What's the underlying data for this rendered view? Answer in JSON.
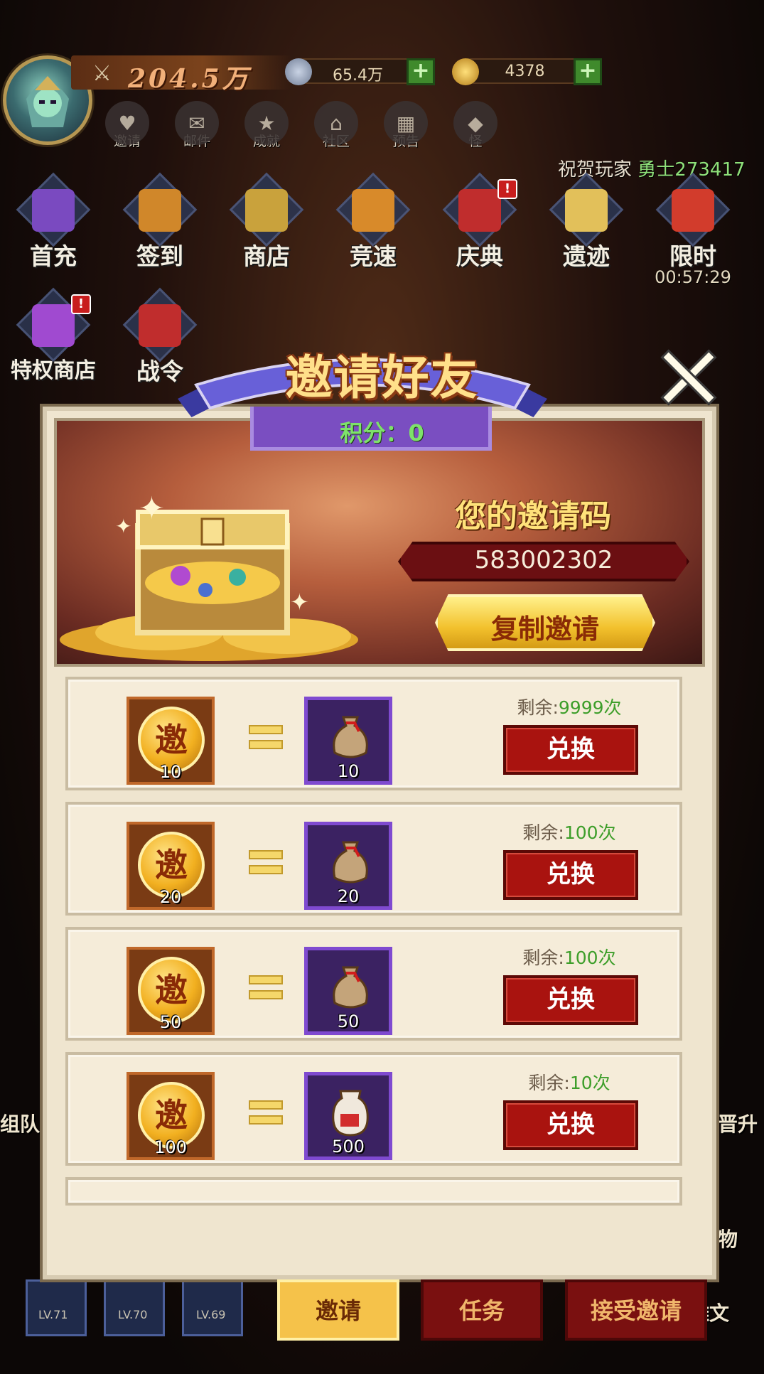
{
  "hud": {
    "power": "204.5万",
    "silver": "65.4万",
    "gold": "4378",
    "plus": "+"
  },
  "top_icons": [
    {
      "label": "邀请",
      "glyph": "♥",
      "icon": "heart-icon"
    },
    {
      "label": "邮件",
      "glyph": "✉",
      "icon": "mail-icon"
    },
    {
      "label": "成就",
      "glyph": "★",
      "icon": "trophy-icon"
    },
    {
      "label": "社区",
      "glyph": "⌂",
      "icon": "home-icon"
    },
    {
      "label": "预告",
      "glyph": "▦",
      "icon": "calendar-icon"
    },
    {
      "label": "怪",
      "glyph": "◆",
      "icon": "monster-icon"
    }
  ],
  "ticker": {
    "prefix": "祝贺玩家",
    "player": "勇士273417"
  },
  "menu_row1": [
    {
      "label": "首充",
      "color": "#7a4ac0"
    },
    {
      "label": "签到",
      "color": "#d0872a"
    },
    {
      "label": "商店",
      "color": "#c9a23c"
    },
    {
      "label": "竞速",
      "color": "#d88a2a"
    },
    {
      "label": "庆典",
      "color": "#c02d2d",
      "badge": "!"
    },
    {
      "label": "遗迹",
      "color": "#e2c05a"
    },
    {
      "label": "限时",
      "color": "#d23c2c",
      "sub": "00:57:29"
    }
  ],
  "menu_row2": [
    {
      "label": "特权商店",
      "color": "#a04ad0",
      "badge": "!"
    },
    {
      "label": "战令",
      "color": "#c02d2d"
    }
  ],
  "side": {
    "left": "组队",
    "right": "晋升",
    "right_bottom": "雕文",
    "right_mid": "物"
  },
  "modal": {
    "title": "邀请好友",
    "score_label": "积分：0",
    "code_label": "您的邀请码",
    "code": "583002302",
    "copy_button": "复制邀请"
  },
  "rewards": [
    {
      "coin_char": "邀",
      "cost": "10",
      "reward": "10",
      "remain_label": "剩余:",
      "remain": "9999次",
      "button": "兑换"
    },
    {
      "coin_char": "邀",
      "cost": "20",
      "reward": "20",
      "remain_label": "剩余:",
      "remain": "100次",
      "button": "兑换"
    },
    {
      "coin_char": "邀",
      "cost": "50",
      "reward": "50",
      "remain_label": "剩余:",
      "remain": "100次",
      "button": "兑换"
    },
    {
      "coin_char": "邀",
      "cost": "100",
      "reward": "500",
      "remain_label": "剩余:",
      "remain": "10次",
      "button": "兑换"
    }
  ],
  "tabs": {
    "invite": "邀请",
    "task": "任务",
    "accept": "接受邀请"
  },
  "heroes": [
    {
      "lv": "LV.71"
    },
    {
      "lv": "LV.70"
    },
    {
      "lv": "LV.69"
    }
  ],
  "colors": {
    "accent_gold": "#f5c24a",
    "button_red": "#a9130f",
    "remain_green": "#3d9e2a"
  }
}
